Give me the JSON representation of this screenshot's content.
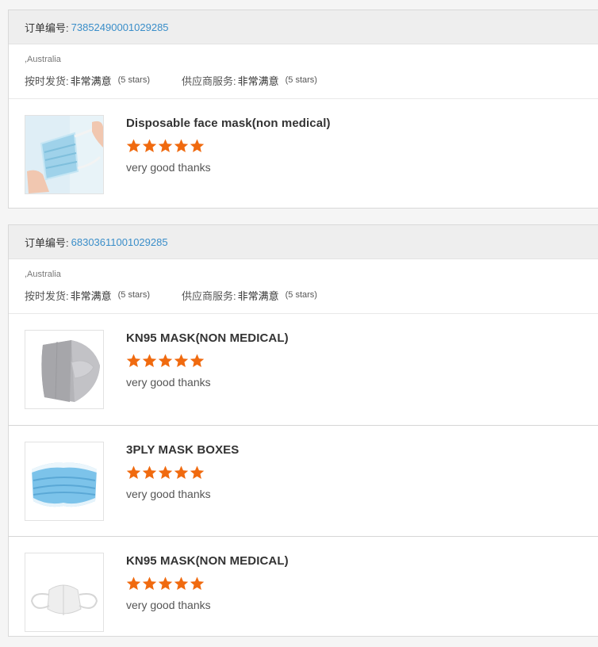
{
  "orders": [
    {
      "order_label": "订单编号:",
      "order_number": "73852490001029285",
      "country": ",Australia",
      "shipping_label": "按时发货:",
      "shipping_value": "非常满意",
      "shipping_stars": "(5 stars)",
      "supplier_label": "供应商服务:",
      "supplier_value": "非常满意",
      "supplier_stars": "(5 stars)",
      "products": [
        {
          "title": "Disposable face mask(non medical)",
          "rating": 5,
          "review": "very good thanks",
          "image_icon": "face-mask-hand-image"
        }
      ]
    },
    {
      "order_label": "订单编号:",
      "order_number": "68303611001029285",
      "country": ",Australia",
      "shipping_label": "按时发货:",
      "shipping_value": "非常满意",
      "shipping_stars": "(5 stars)",
      "supplier_label": "供应商服务:",
      "supplier_value": "非常满意",
      "supplier_stars": "(5 stars)",
      "products": [
        {
          "title": "KN95 MASK(NON MEDICAL)",
          "rating": 5,
          "review": "very good thanks",
          "image_icon": "kn95-grey-mask-image"
        },
        {
          "title": "3PLY MASK BOXES",
          "rating": 5,
          "review": "very good thanks",
          "image_icon": "blue-surgical-mask-image"
        },
        {
          "title": "KN95 MASK(NON MEDICAL)",
          "rating": 5,
          "review": "very good thanks",
          "image_icon": "kn95-white-mask-image"
        }
      ]
    }
  ],
  "colors": {
    "star": "#f06a0f",
    "order_number": "#3a8ec9",
    "header_bg": "#eeeeee"
  }
}
